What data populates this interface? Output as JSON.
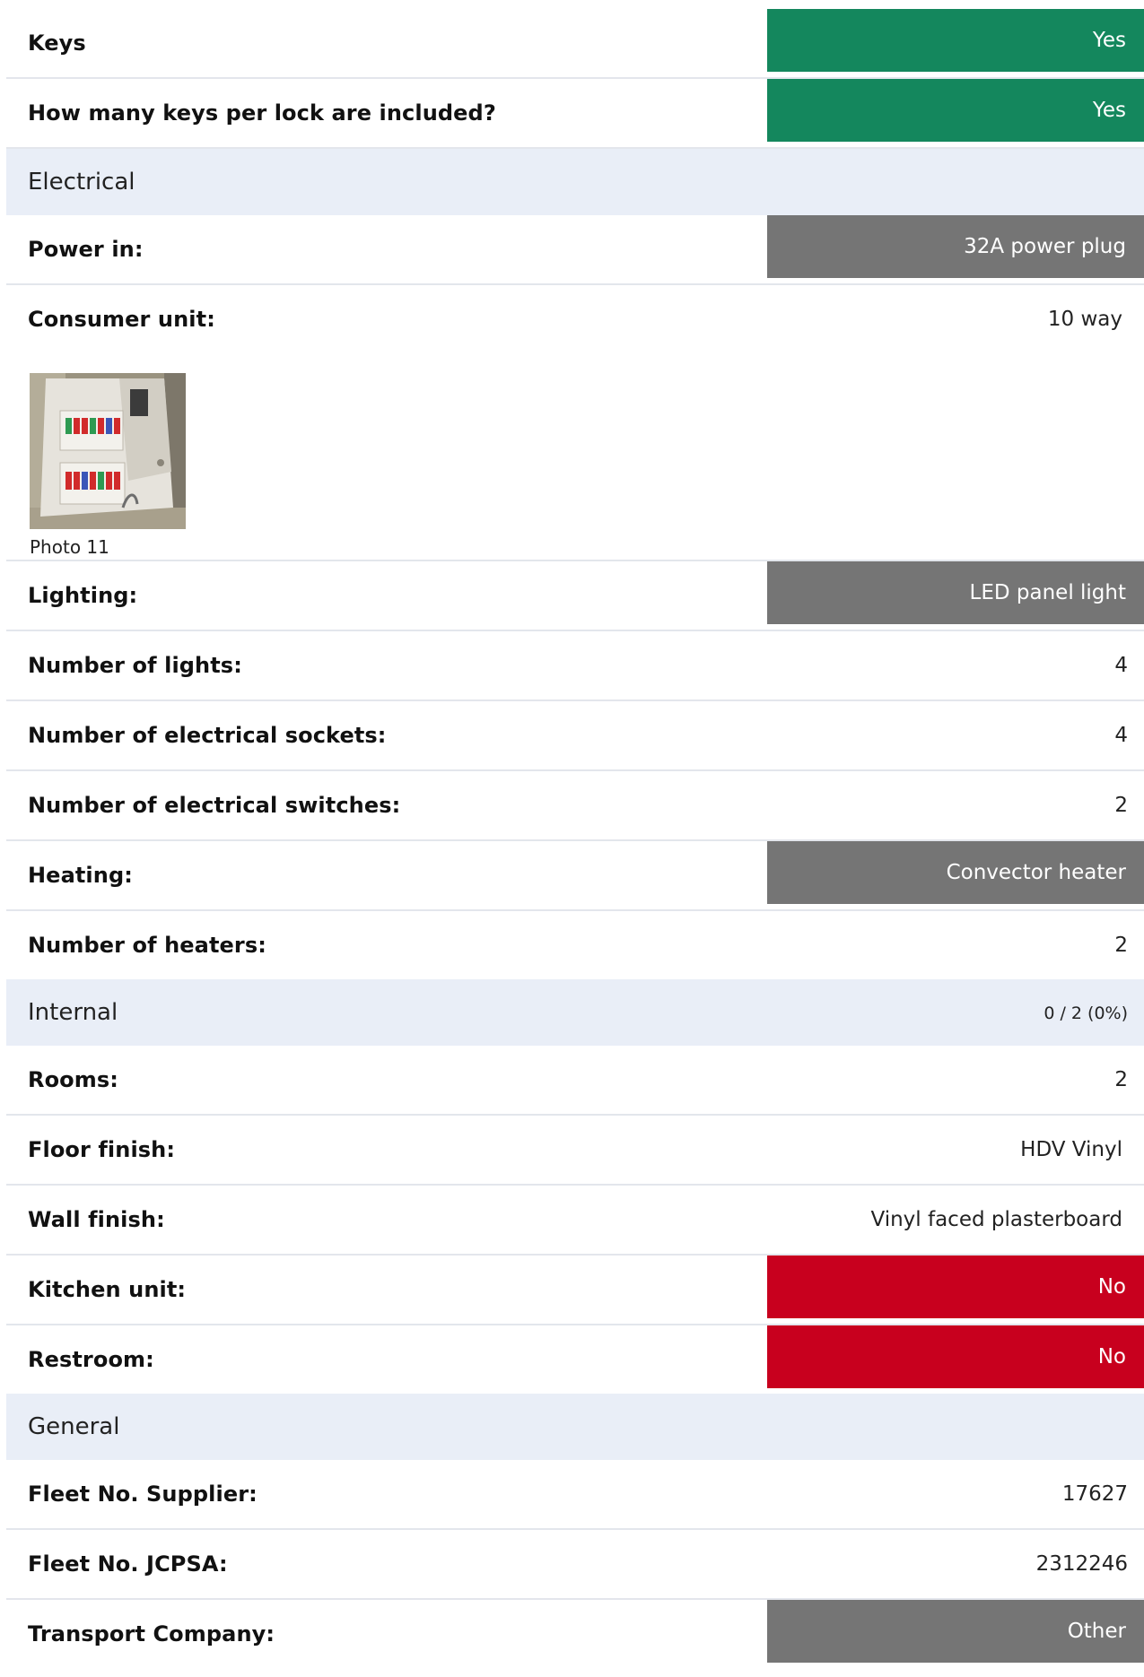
{
  "rows_top": [
    {
      "label": "Keys",
      "value": "Yes",
      "style": "green"
    },
    {
      "label": "How many keys per lock are included?",
      "value": "Yes",
      "style": "green"
    }
  ],
  "section_electrical": {
    "title": "Electrical"
  },
  "power_in": {
    "label": "Power in:",
    "value": "32A power plug"
  },
  "consumer_unit": {
    "label": "Consumer unit:",
    "value": "10 way"
  },
  "photo": {
    "caption": "Photo 11"
  },
  "lighting": {
    "label": "Lighting:",
    "value": "LED panel light"
  },
  "number_of_lights": {
    "label": "Number of lights:",
    "value": "4"
  },
  "number_of_sockets": {
    "label": "Number of electrical sockets:",
    "value": "4"
  },
  "number_of_switches": {
    "label": "Number of electrical switches:",
    "value": "2"
  },
  "heating": {
    "label": "Heating:",
    "value": "Convector heater"
  },
  "number_of_heaters": {
    "label": "Number of heaters:",
    "value": "2"
  },
  "section_internal": {
    "title": "Internal",
    "progress": "0 / 2 (0%)"
  },
  "rooms": {
    "label": "Rooms:",
    "value": "2"
  },
  "floor_finish": {
    "label": "Floor finish:",
    "value": "HDV Vinyl"
  },
  "wall_finish": {
    "label": "Wall finish:",
    "value": "Vinyl faced plasterboard"
  },
  "kitchen_unit": {
    "label": "Kitchen unit:",
    "value": "No"
  },
  "restroom": {
    "label": "Restroom:",
    "value": "No"
  },
  "section_general": {
    "title": "General"
  },
  "fleet_no_supplier": {
    "label": "Fleet No. Supplier:",
    "value": "17627"
  },
  "fleet_no_jcpsa": {
    "label": "Fleet No. JCPSA:",
    "value": "2312246"
  },
  "transport_company": {
    "label": "Transport Company:",
    "value": "Other"
  },
  "colors": {
    "green": "#14875d",
    "grey": "#757575",
    "red": "#c8001e",
    "section_bg": "#e9eef7"
  }
}
